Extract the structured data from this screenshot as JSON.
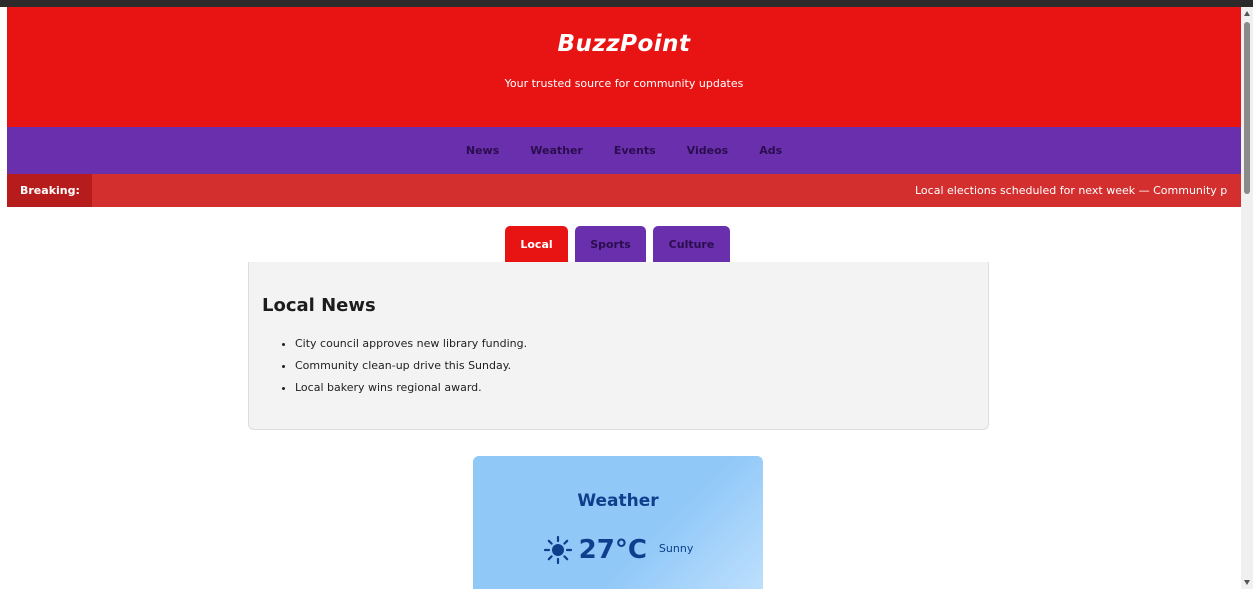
{
  "header": {
    "title": "BuzzPoint",
    "tagline": "Your trusted source for community updates"
  },
  "nav": {
    "items": [
      "News",
      "Weather",
      "Events",
      "Videos",
      "Ads"
    ]
  },
  "breaking": {
    "label": "Breaking:",
    "text": "Local elections scheduled for next week — Community p"
  },
  "tabs": {
    "items": [
      "Local",
      "Sports",
      "Culture"
    ],
    "active": "Local"
  },
  "news": {
    "title": "Local News",
    "items": [
      "City council approves new library funding.",
      "Community clean-up drive this Sunday.",
      "Local bakery wins regional award."
    ]
  },
  "weather": {
    "title": "Weather",
    "icon": "sun-icon",
    "temperature": "27°C",
    "condition": "Sunny"
  },
  "colors": {
    "header": "#e81414",
    "nav": "#6a2fac",
    "breaking": "#d32f2f",
    "breaking_label": "#b71c1c",
    "weather_text": "#0d3f8c"
  }
}
